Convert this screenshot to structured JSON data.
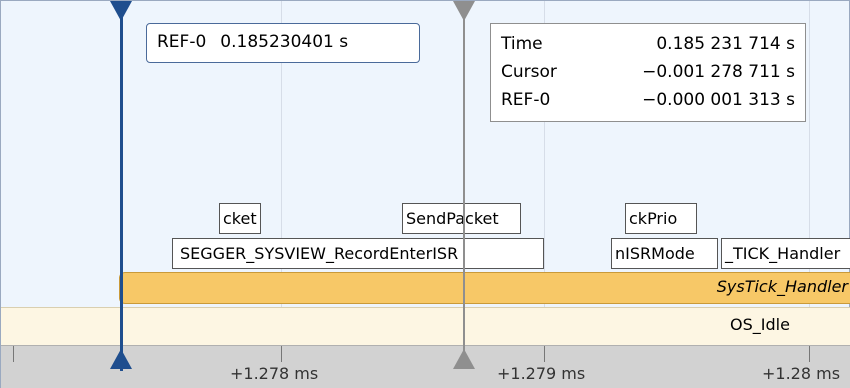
{
  "reference_marker": {
    "label": "REF-0",
    "value": "0.185230401 s"
  },
  "info": {
    "rows": [
      {
        "label": "Time",
        "value": "0.185 231 714 s"
      },
      {
        "label": "Cursor",
        "value": "−0.001 278 711 s"
      },
      {
        "label": "REF-0",
        "value": "−0.000 001 313 s"
      }
    ]
  },
  "events": {
    "top_row": [
      "cket",
      "SendPacket",
      "ckPrio"
    ],
    "mid_row": [
      "SEGGER_SYSVIEW_RecordEnterISR",
      "nISRMode",
      "_TICK_Handler"
    ]
  },
  "tracks": {
    "systick": "SysTick_Handler",
    "idle": "OS_Idle"
  },
  "axis": {
    "ticks": [
      "+1.278 ms",
      "+1.279 ms",
      "+1.28 ms"
    ]
  },
  "colors": {
    "reference": "#1f4e8e",
    "cursor": "#8f8f8f",
    "systick": "#f7c867",
    "idle": "#fdf6e3"
  }
}
